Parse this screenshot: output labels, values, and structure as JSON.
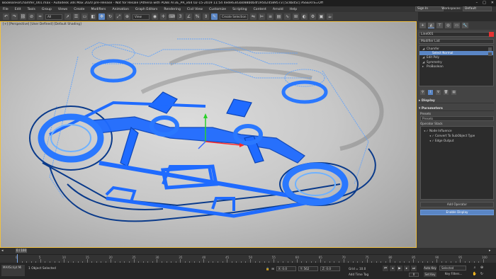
{
  "titlebar": {
    "title": "BooleanForChamfer_001.max - Autodesk 3ds Max 2020 pre-release - Not for Resale (Athena with PDBs AT3E_PR_x64 02-15-2019 11:54 4ede63d3a088b0b4f195024589573 [5c4bd5c] ASSERTS=Off",
    "min": "–",
    "max": "□",
    "close": "✕"
  },
  "menu": [
    "File",
    "Edit",
    "Tools",
    "Group",
    "Views",
    "Create",
    "Modifiers",
    "Animation",
    "Graph Editors",
    "Rendering",
    "Civil View",
    "Customize",
    "Scripting",
    "Content",
    "Arnold",
    "Help"
  ],
  "signin": "Sign In",
  "workspaces_label": "Workspaces:",
  "workspace_value": "Default",
  "toolbar": {
    "filter": "All",
    "view": "View",
    "selection_set": "Create Selection Se"
  },
  "viewport": {
    "label": "[+] [Perspective] [User Defined] [Default Shading]"
  },
  "command_panel": {
    "object_name": "Line001",
    "name_color": "#e53333",
    "modifier_list": "Modifier List",
    "stack": [
      {
        "label": "Chamfer",
        "indent": 0,
        "selected": false,
        "icon": "◢"
      },
      {
        "label": "Select Normal",
        "indent": 1,
        "selected": true,
        "icon": ""
      },
      {
        "label": "Edit Poly",
        "indent": 0,
        "selected": false,
        "icon": "◢"
      },
      {
        "label": "Symmetry",
        "indent": 0,
        "selected": false,
        "icon": "◢"
      },
      {
        "label": "ProBoolean",
        "indent": 0,
        "selected": false,
        "icon": "▸"
      }
    ],
    "display_rollout": "Display",
    "parameters_rollout": "Parameters",
    "presets_label": "Presets",
    "presets_value": "Presets",
    "operator_stack_label": "Operator Stack",
    "operators": [
      {
        "label": "Node Influence",
        "indent": 0
      },
      {
        "label": "Convert To SubObject Type",
        "indent": 1
      },
      {
        "label": "Edge Output",
        "indent": 1
      }
    ],
    "add_operator": "Add Operator",
    "enable_display": "Enable Display"
  },
  "timeline": {
    "slider": "0 / 100",
    "ticks": [
      "0",
      "5",
      "10",
      "15",
      "20",
      "25",
      "30",
      "35",
      "40",
      "45",
      "50",
      "55",
      "60",
      "65",
      "70",
      "75",
      "80",
      "85",
      "90",
      "95",
      "100"
    ]
  },
  "status": {
    "maxscript": [
      "MAXScript Mi",
      ""
    ],
    "objects_selected": "1 Object Selected",
    "x": "X: 0.0",
    "y": "Y: 562",
    "z": "Z: 0.0",
    "grid": "Grid = 10.0",
    "add_time_tag": "Add Time Tag",
    "auto_key": "Auto Key",
    "selected": "Selected",
    "set_key": "Set Key",
    "key_filters": "Key Filters...",
    "frame": "0"
  },
  "colors": {
    "accent": "#5a86c5",
    "mesh": "#1f6bff",
    "frame": "#f0c040"
  }
}
